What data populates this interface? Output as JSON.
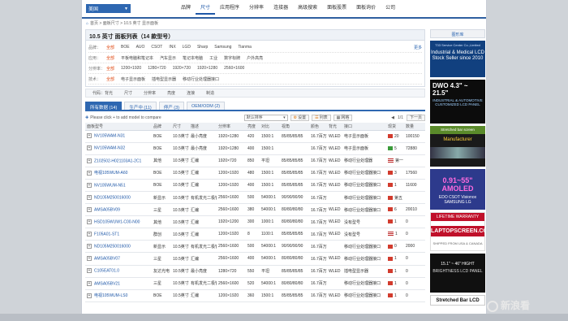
{
  "region": "美国",
  "nav": [
    "品牌",
    "尺寸",
    "应用程序",
    "分辨率",
    "连接器",
    "高级搜索",
    "面板股票",
    "面板询价",
    "公司"
  ],
  "nav_active_index": 1,
  "breadcrumb": "首页 > 面板尺寸 > 10.5 英寸 显示面板",
  "page_title": "10.5 英寸 面板列表（14 款型号）",
  "filters": [
    {
      "label": "品牌：",
      "options": [
        "全部",
        "BOE",
        "AUO",
        "CSOT",
        "INX",
        "LGD",
        "Sharp",
        "Samsung",
        "Tianma",
        "更多"
      ],
      "selected": 0,
      "more": "更多"
    },
    {
      "label": "应用：",
      "options": [
        "全部",
        "平板电脑和笔记本",
        "汽车显示",
        "笔记本电脑",
        "工业",
        "数字标牌",
        "户外高亮"
      ],
      "selected": 0,
      "more": ""
    },
    {
      "label": "分辨率：",
      "options": [
        "全部",
        "1200×1920",
        "1280×720",
        "1920×720",
        "1920×1280",
        "2560×1600"
      ],
      "selected": 0,
      "more": ""
    },
    {
      "label": "技术：",
      "options": [
        "全部",
        "电子显示面板",
        "插电型显示器",
        "移动行业处理器接口"
      ],
      "selected": 0,
      "more": ""
    }
  ],
  "sort_options": [
    "代码：背光",
    "尺寸",
    "分辨率",
    "亮度",
    "连接",
    "制造"
  ],
  "tabs": [
    {
      "label": "所有数据 (14)",
      "active": true
    },
    {
      "label": "生产中 (11)",
      "active": false
    },
    {
      "label": "停产 (3)",
      "active": false
    },
    {
      "label": "OEM/ODM (2)",
      "active": false
    }
  ],
  "toolbar": {
    "compare_hint": "Please click + to add model to compare",
    "sort_select": "默认排序",
    "btn_settings": "设置",
    "btn_list": "列表",
    "btn_grid": "网格",
    "page": "1/1",
    "next": "下一页"
  },
  "columns": [
    "面板型号",
    "品牌",
    "尺寸",
    "描述",
    "分辨率",
    "亮度",
    "对比",
    "视角",
    "颜色",
    "背光",
    "接口",
    "现货",
    "数量"
  ],
  "rows": [
    {
      "model": "NV105WAM-N31",
      "brand": "BOE",
      "size": "10.5英寸",
      "desc": "最小亮度",
      "res": "1920×1280",
      "bright": "420",
      "contrast": "1500:1",
      "view": "85/85/85/85",
      "color": "16.7百万",
      "bl": "WLED",
      "iface": "电子显示面板",
      "stock": "red",
      "qty": "20",
      "count": "100150"
    },
    {
      "model": "NV105WAM-N32",
      "brand": "BOE",
      "size": "10.5英寸",
      "desc": "最小亮度",
      "res": "1920×1280",
      "bright": "400",
      "contrast": "1500:1",
      "view": "",
      "color": "16.7百万",
      "bl": "WLED",
      "iface": "电子显示面板",
      "stock": "green",
      "qty": "5",
      "count": "72880"
    },
    {
      "model": "Z102502-H021103A1-2C1",
      "brand": "其他",
      "size": "10.5英寸",
      "desc": "汇编",
      "res": "1920×720",
      "bright": "850",
      "contrast": "平坦",
      "view": "85/85/85/85",
      "color": "16.7百万",
      "bl": "WLED",
      "iface": "移动行业处理器",
      "stock": "flag",
      "qty": "第一",
      "count": ""
    },
    {
      "model": "电视105WUM-A60",
      "brand": "BOE",
      "size": "10.5英寸",
      "desc": "汇编",
      "res": "1200×1920",
      "bright": "480",
      "contrast": "1500:1",
      "view": "85/85/85/85",
      "color": "16.7百万",
      "bl": "WLED",
      "iface": "移动行业处理器接口",
      "stock": "red",
      "qty": "3",
      "count": "17560"
    },
    {
      "model": "NV105WUM-N51",
      "brand": "BOE",
      "size": "10.5英寸",
      "desc": "汇编",
      "res": "1200×1920",
      "bright": "400",
      "contrast": "1500:1",
      "view": "85/85/85/85",
      "color": "16.7百万",
      "bl": "WLED",
      "iface": "移动行业处理器接口",
      "stock": "red",
      "qty": "1",
      "count": "11600"
    },
    {
      "model": "ND105M250016000",
      "brand": "新显示",
      "size": "10.5英寸",
      "desc": "有机发光二极管",
      "res": "2560×1600",
      "bright": "500",
      "contrast": "54000:1",
      "view": "90/90/90/90",
      "color": "16.7百万",
      "bl": "",
      "iface": "移动行业处理器接口",
      "stock": "red",
      "qty": "第五",
      "count": ""
    },
    {
      "model": "AMSA05BV09",
      "brand": "三星",
      "size": "10.5英寸",
      "desc": "汇编",
      "res": "2560×1600",
      "bright": "380",
      "contrast": "54000:1",
      "view": "80/80/80/80",
      "color": "16.7百万",
      "bl": "WLED",
      "iface": "移动行业处理器接口",
      "stock": "red",
      "qty": "6",
      "count": "20010"
    },
    {
      "model": "HSD105WUW1-C00-N00",
      "brand": "其他",
      "size": "10.5英寸",
      "desc": "汇编",
      "res": "1920×1200",
      "bright": "300",
      "contrast": "1000:1",
      "view": "80/80/80/80",
      "color": "16.7百万",
      "bl": "WLED",
      "iface": "没有型号",
      "stock": "red",
      "qty": "1",
      "count": "0"
    },
    {
      "model": "F105A01-ST1",
      "brand": "群创",
      "size": "10.5英寸",
      "desc": "汇编",
      "res": "1200×1920",
      "bright": "8",
      "contrast": "1100:1",
      "view": "85/85/85/85",
      "color": "16.7百万",
      "bl": "WLED",
      "iface": "没有型号",
      "stock": "flag",
      "qty": "1",
      "count": "0"
    },
    {
      "model": "ND105M250016000",
      "brand": "新显示",
      "size": "10.5英寸",
      "desc": "有机发光二极管",
      "res": "2560×1600",
      "bright": "500",
      "contrast": "54000:1",
      "view": "90/90/90/90",
      "color": "16.7百万",
      "bl": "",
      "iface": "移动行业处理器接口",
      "stock": "red",
      "qty": "0",
      "count": "2000"
    },
    {
      "model": "AMSA05BV07",
      "brand": "三星",
      "size": "10.5英寸",
      "desc": "汇编",
      "res": "2560×1600",
      "bright": "400",
      "contrast": "54000:1",
      "view": "80/80/80/80",
      "color": "16.7百万",
      "bl": "WLED",
      "iface": "移动行业处理器接口",
      "stock": "red",
      "qty": "1",
      "count": "0"
    },
    {
      "model": "C105EAT01.0",
      "brand": "友达光电",
      "size": "10.5英寸",
      "desc": "最小亮度",
      "res": "1280×720",
      "bright": "550",
      "contrast": "平坦",
      "view": "85/85/85/85",
      "color": "16.7百万",
      "bl": "WLED",
      "iface": "插电型显示器",
      "stock": "red",
      "qty": "1",
      "count": "0"
    },
    {
      "model": "AMSA05BV21",
      "brand": "三星",
      "size": "10.5英寸",
      "desc": "有机发光二极管",
      "res": "2560×1600",
      "bright": "520",
      "contrast": "54000:1",
      "view": "80/80/80/80",
      "color": "16.7百万",
      "bl": "",
      "iface": "移动行业处理器接口",
      "stock": "red",
      "qty": "1",
      "count": "0"
    },
    {
      "model": "电视105WUM-LS0",
      "brand": "BOE",
      "size": "10.5英寸",
      "desc": "汇编",
      "res": "1200×1920",
      "bright": "360",
      "contrast": "1500:1",
      "view": "85/85/85/85",
      "color": "16.7百万",
      "bl": "WLED",
      "iface": "移动行业处理器接口",
      "stock": "red",
      "qty": "1",
      "count": "0"
    }
  ],
  "side": {
    "header": "图形库",
    "ad1": {
      "small": "T33 Service Center Co.,Limited",
      "big": "Industrial & Medical LCD Stock Seller since 2010"
    },
    "ad2": {
      "big": "DWO 4.3\" ~ 21.5\"",
      "small": "INDUSTRIAL & AUTOMOTIVE CUSTOMIZED LCD PANEL"
    },
    "ad3": {
      "top": "Stretched bar screen",
      "mid": "Manufacturer"
    },
    "ad4": {
      "big": "0.91~55\" AMOLED",
      "small": "EDO CSOT Visionox SAMSUNG LG"
    },
    "ad5": {
      "top": "LIFETIME WARRANTY",
      "big": "LAPTOPSCREEN.COM",
      "small": "SHIPPED FROM USA & CANADA"
    },
    "ad6": {
      "big": "15.1\" ~ 46\" HIGHT",
      "small": "BRIGHTNESS LCD PANEL"
    },
    "ad7": "Stretched Bar LCD"
  },
  "watermark": "新浪看"
}
